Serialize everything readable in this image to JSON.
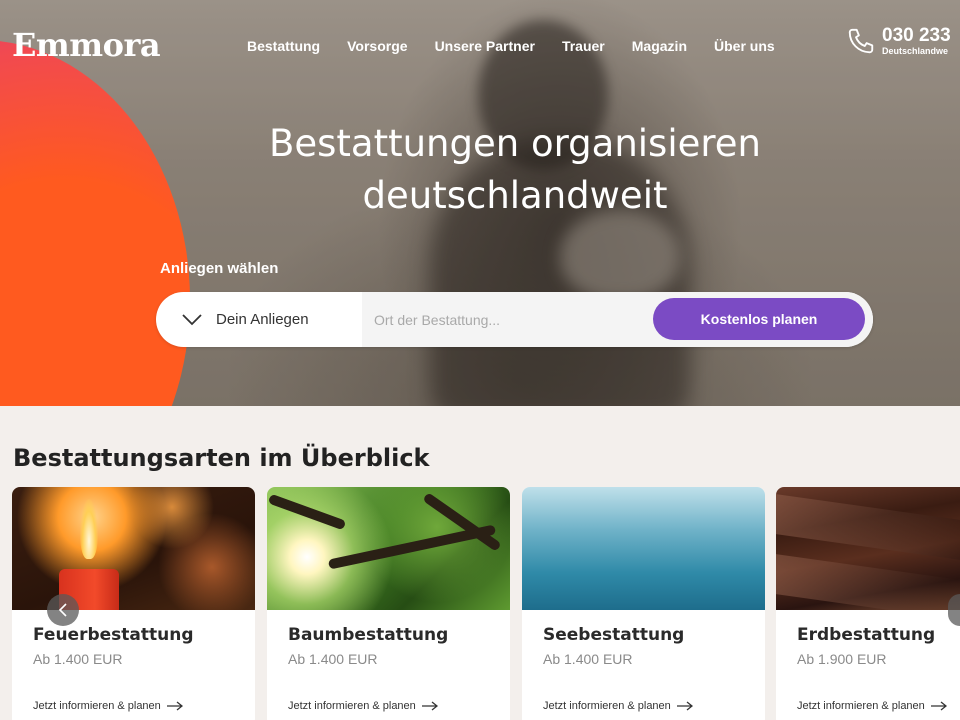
{
  "header": {
    "logo": "Emmora",
    "nav": [
      {
        "label": "Bestattung"
      },
      {
        "label": "Vorsorge"
      },
      {
        "label": "Unsere Partner"
      },
      {
        "label": "Trauer"
      },
      {
        "label": "Magazin"
      },
      {
        "label": "Über uns"
      }
    ],
    "phone": {
      "number": "030 233",
      "sub": "Deutschlandwe",
      "icon": "phone-icon"
    }
  },
  "hero": {
    "title_line1": "Bestattungen organisieren",
    "title_line2": "deutschlandweit",
    "anliegen_label": "Anliegen wählen",
    "select_value": "Dein Anliegen",
    "ort_placeholder": "Ort der Bestattung...",
    "cta_label": "Kostenlos planen"
  },
  "section": {
    "title": "Bestattungsarten im Überblick",
    "cards": [
      {
        "name": "Feuerbestattung",
        "price": "Ab 1.400 EUR",
        "link": "Jetzt informieren & planen"
      },
      {
        "name": "Baumbestattung",
        "price": "Ab 1.400 EUR",
        "link": "Jetzt informieren & planen"
      },
      {
        "name": "Seebestattung",
        "price": "Ab 1.400 EUR",
        "link": "Jetzt informieren & planen"
      },
      {
        "name": "Erdbestattung",
        "price": "Ab 1.900 EUR",
        "link": "Jetzt informieren & planen"
      }
    ]
  },
  "colors": {
    "accent": "#7b4bc4",
    "blob": "#ff5a1f",
    "section_bg": "#f3efec"
  }
}
